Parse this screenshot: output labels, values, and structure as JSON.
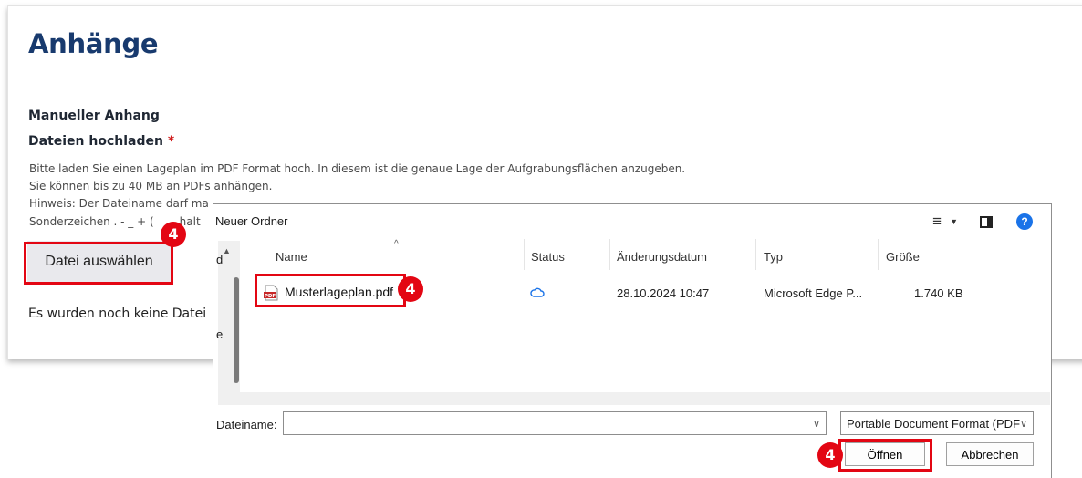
{
  "page": {
    "title": "Anhänge",
    "section_label": "Manueller Anhang",
    "upload_label": "Dateien hochladen",
    "required_marker": "*",
    "hints": [
      "Bitte laden Sie einen Lageplan im PDF Format hoch. In diesem ist die genaue Lage der Aufgrabungsflächen anzugeben.",
      "Sie können bis zu 40 MB an PDFs anhängen.",
      "Hinweis: Der Dateiname darf ma",
      "Sonderzeichen . - _ + ("
    ],
    "hint4_tail": "halt",
    "choose_file_button": "Datei auswählen",
    "no_files_text": "Es wurden noch keine Datei"
  },
  "dialog": {
    "folder": "Neuer Ordner",
    "nav_letters": [
      "d",
      "e"
    ],
    "columns": [
      "Name",
      "Status",
      "Änderungsdatum",
      "Typ",
      "Größe"
    ],
    "files": [
      {
        "name": "Musterlageplan.pdf",
        "status_icon": "cloud-icon",
        "modified": "28.10.2024 10:47",
        "type": "Microsoft Edge P...",
        "size": "1.740 KB"
      }
    ],
    "filename_label": "Dateiname:",
    "filename_value": "",
    "file_type": "Portable Document Format (PDF",
    "open_button": "Öffnen",
    "cancel_button": "Abbrechen",
    "help_glyph": "?"
  },
  "annotations": {
    "step": "4",
    "color": "#e30613"
  },
  "colors": {
    "title": "#183a6e",
    "required": "#d01d1d",
    "help_blue": "#1a73e8"
  }
}
